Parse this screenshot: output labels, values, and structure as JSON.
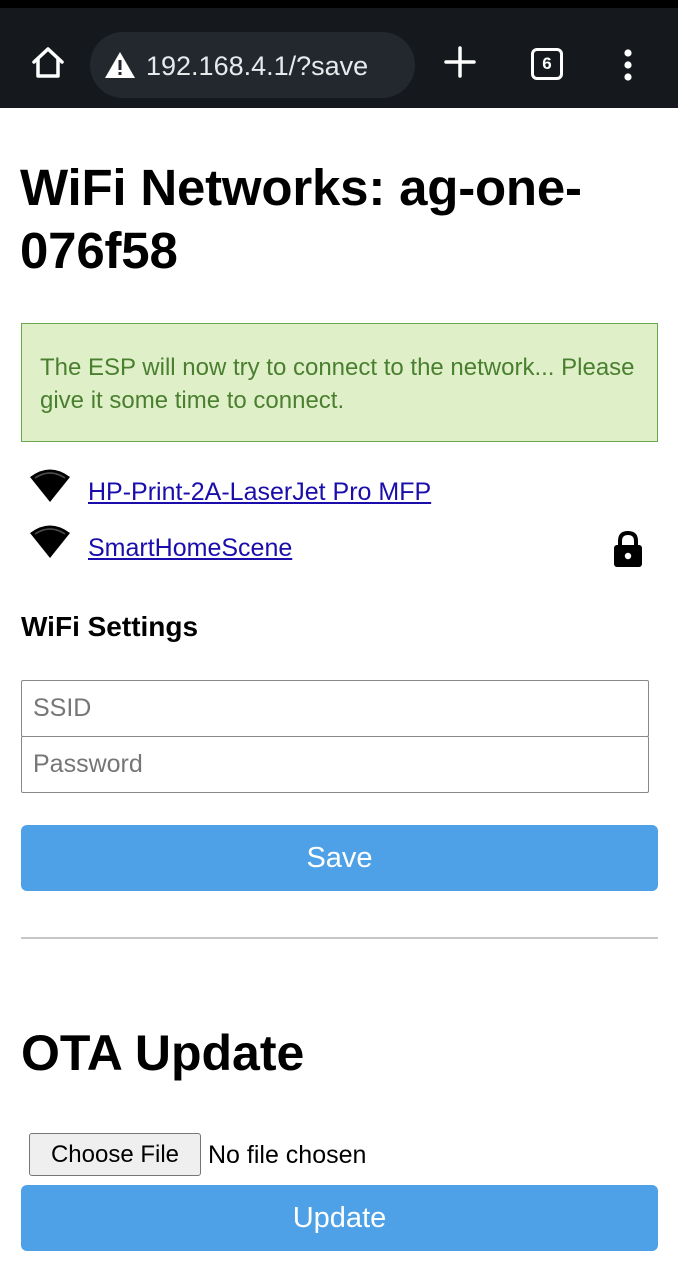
{
  "browser": {
    "url": "192.168.4.1/?save",
    "tab_count": "6",
    "icons": {
      "home": "home-icon",
      "warning": "warning-icon",
      "new_tab": "plus-icon",
      "menu": "more-vert-icon"
    }
  },
  "page": {
    "title": "WiFi Networks: ag-one-076f58",
    "alert_message": "The ESP will now try to connect to the network... Please give it some time to connect.",
    "networks": [
      {
        "ssid": "HP-Print-2A-LaserJet Pro MFP",
        "icon": "wifi-signal-icon",
        "locked": false
      },
      {
        "ssid": "SmartHomeScene",
        "icon": "wifi-signal-icon",
        "locked": true,
        "lock_icon": "lock-icon"
      }
    ],
    "wifi_settings": {
      "heading": "WiFi Settings",
      "ssid_placeholder": "SSID",
      "password_placeholder": "Password",
      "save_label": "Save"
    },
    "ota": {
      "heading": "OTA Update",
      "choose_file_label": "Choose File",
      "file_status": "No file chosen",
      "update_label": "Update"
    }
  },
  "colors": {
    "topbar_bg": "#15191d",
    "alert_bg": "#dff0c8",
    "alert_text": "#4a7f30",
    "button_bg": "#4ea1e6",
    "link": "#1a0dab"
  }
}
